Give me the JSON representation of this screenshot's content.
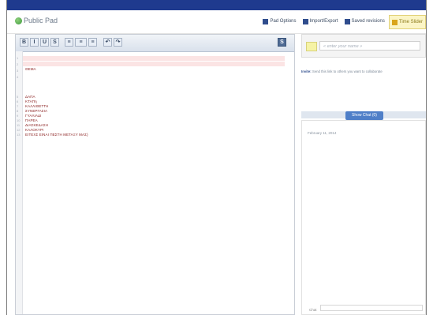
{
  "app": {
    "title": "Public Pad"
  },
  "header_actions": [
    {
      "label": "Pad Options",
      "icon": "pad-options-icon"
    },
    {
      "label": "Import/Export",
      "icon": "import-export-icon"
    },
    {
      "label": "Saved revisions",
      "icon": "saved-revisions-icon"
    },
    {
      "label": "Time Slider",
      "icon": "time-slider-icon"
    }
  ],
  "toolbar": {
    "buttons": [
      "B",
      "I",
      "U",
      "S",
      "≡",
      "≡",
      "≡",
      "↶",
      "↷"
    ],
    "save_label": "S"
  },
  "editor": {
    "lines": [
      {
        "n": "1",
        "text": ""
      },
      {
        "n": "2",
        "text": "ΘΕΜΑ"
      },
      {
        "n": "3",
        "text": ""
      },
      {
        "n": "4",
        "text": ""
      },
      {
        "n": "5",
        "text": "ΔΑΠΑ"
      },
      {
        "n": "6",
        "text": "ΚΤΑΠη"
      },
      {
        "n": "7",
        "text": "ΚΑΛΛΙΘΕΤΤΗ"
      },
      {
        "n": "8",
        "text": "ΣΥΝΕΡΓΑΣΙΑ"
      },
      {
        "n": "9",
        "text": "ΓΥΑΛΙΑΔΙ"
      },
      {
        "n": "10",
        "text": "ΠΑΡΕΑ"
      },
      {
        "n": "11",
        "text": "ΔΙΑΣΚΕΔΑΣΗ"
      },
      {
        "n": "12",
        "text": "ΚΑΛΟΚΥΡΙ"
      },
      {
        "n": "13",
        "text": "ΕΙΤΕΧΣ ΕΙΝΑΙ ΠΕΣΤΗ ΜΕΤΑΞΥ ΜΑΣ)"
      }
    ]
  },
  "sidebar": {
    "name_placeholder": "« enter your name »",
    "invite_link": "Invite:",
    "invite_text": "Send this link to others you want to collaborate",
    "chat_button": "Show Chat (0)",
    "chat_date": "February 11, 2014",
    "chat_input_label": "Chat"
  },
  "colors": {
    "top_bar": "#1f3a8e",
    "accent": "#4f7fc8",
    "line_text": "#8a2020",
    "highlight": "#fbe4e4"
  }
}
